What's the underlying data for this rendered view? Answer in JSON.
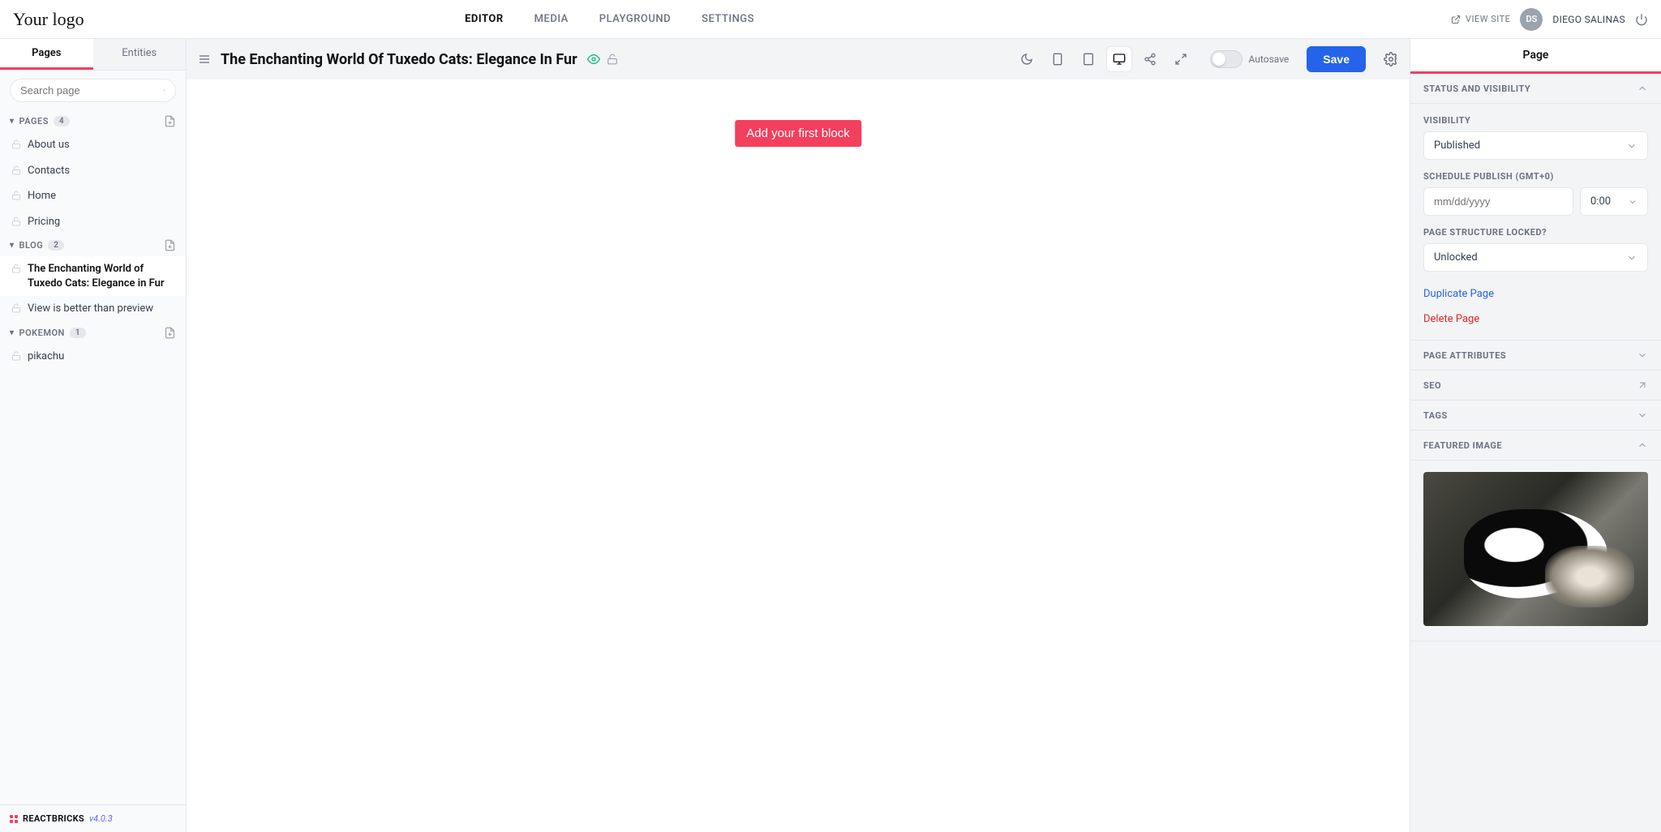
{
  "topbar": {
    "logo": "Your logo",
    "nav": [
      "EDITOR",
      "MEDIA",
      "PLAYGROUND",
      "SETTINGS"
    ],
    "view_site": "VIEW SITE",
    "avatar_initials": "DS",
    "username": "DIEGO SALINAS"
  },
  "left": {
    "tabs": [
      "Pages",
      "Entities"
    ],
    "search_placeholder": "Search page",
    "groups": [
      {
        "name": "PAGES",
        "count": "4",
        "items": [
          "About us",
          "Contacts",
          "Home",
          "Pricing"
        ]
      },
      {
        "name": "BLOG",
        "count": "2",
        "items": [
          "The Enchanting World of Tuxedo Cats: Elegance in Fur",
          "View is better than preview"
        ]
      },
      {
        "name": "POKEMON",
        "count": "1",
        "items": [
          "pikachu"
        ]
      }
    ],
    "brand": "REACTBRICKS",
    "version": "v4.0.3"
  },
  "header": {
    "title": "The Enchanting World Of Tuxedo Cats: Elegance In Fur",
    "autosave": "Autosave",
    "save": "Save"
  },
  "canvas": {
    "add_block": "Add your first block"
  },
  "right": {
    "tab": "Page",
    "sections": {
      "status": {
        "title": "STATUS AND VISIBILITY",
        "visibility_label": "VISIBILITY",
        "visibility_value": "Published",
        "schedule_label": "SCHEDULE PUBLISH (GMT+0)",
        "date_placeholder": "mm/dd/yyyy",
        "time_value": "0:00",
        "lock_label": "PAGE STRUCTURE LOCKED?",
        "lock_value": "Unlocked",
        "duplicate": "Duplicate Page",
        "delete": "Delete Page"
      },
      "attributes": "PAGE ATTRIBUTES",
      "seo": "SEO",
      "tags": "TAGS",
      "featured": "FEATURED IMAGE"
    }
  }
}
